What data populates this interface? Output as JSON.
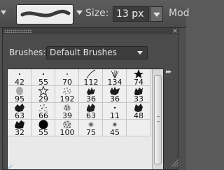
{
  "options_bar": {
    "size_label": "Size:",
    "size_value": "13 px",
    "mode_label_partial": "Mod"
  },
  "popup": {
    "brushes_label": "Brushes:",
    "brush_set_selected": "Default Brushes",
    "close_glyph": "×",
    "menu_glyph": "▸▸",
    "brush_sizes": [
      [
        "42",
        "55",
        "70",
        "112",
        "134",
        "74"
      ],
      [
        "95",
        "29",
        "192",
        "36",
        "36",
        "33"
      ],
      [
        "63",
        "66",
        "39",
        "63",
        "11",
        "48"
      ],
      [
        "32",
        "55",
        "100",
        "75",
        "45",
        ""
      ]
    ]
  },
  "icons": {
    "tool": "triangle-arrow-icon",
    "preview_menu": "chevron-down-icon",
    "panel_menu": "double-chevron-right-icon",
    "resize": "resize-grip-icon",
    "status": "magic-wand-icon"
  },
  "colors": {
    "toolbar_bg": "#4f4f4f",
    "grid_bg": "#efefef",
    "text_light": "#e4e4e4"
  }
}
